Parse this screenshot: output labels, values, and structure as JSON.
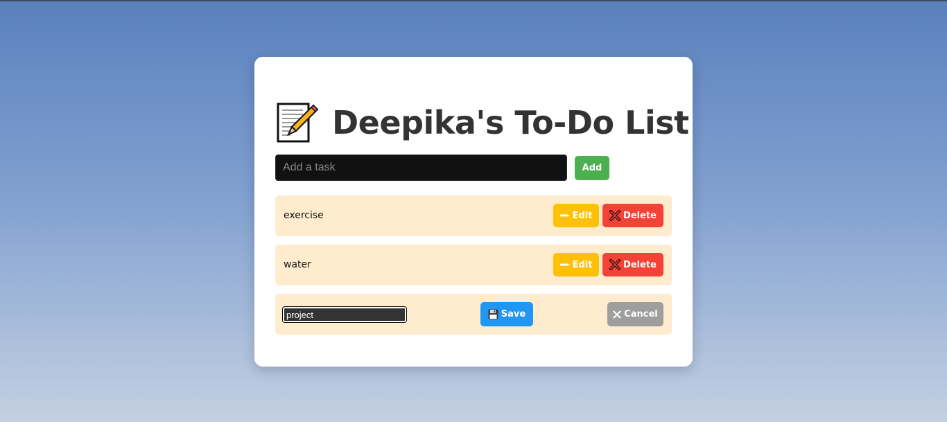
{
  "header": {
    "title": "Deepika's To-Do List",
    "icon": "memo-icon"
  },
  "add_form": {
    "placeholder": "Add a task",
    "value": "",
    "add_label": "Add"
  },
  "tasks": [
    {
      "text": "exercise",
      "edit_label": "Edit",
      "delete_label": "Delete",
      "editing": false
    },
    {
      "text": "water",
      "edit_label": "Edit",
      "delete_label": "Delete",
      "editing": false
    },
    {
      "text": "project",
      "save_label": "Save",
      "cancel_label": "Cancel",
      "editing": true
    }
  ],
  "colors": {
    "add": "#4caf50",
    "edit": "#ffc107",
    "delete": "#f44336",
    "save": "#2196f3",
    "cancel": "#9e9e9e",
    "task_bg": "#ffebcd"
  }
}
